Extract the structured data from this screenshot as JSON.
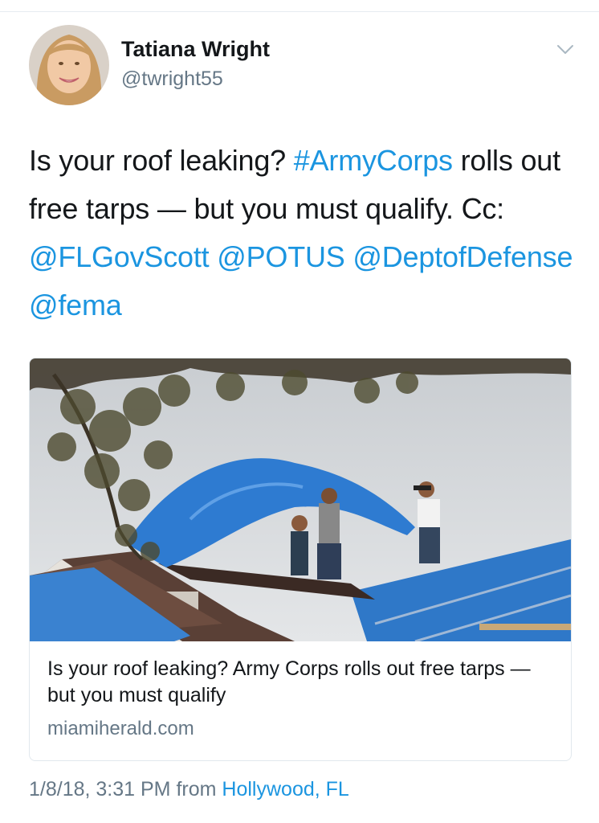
{
  "tweet": {
    "author": {
      "display_name": "Tatiana Wright",
      "handle": "@twright55"
    },
    "menu_icon": "chevron-down-icon",
    "text": {
      "part1": "Is your roof leaking? ",
      "hashtag": "#ArmyCorps",
      "part2": " rolls out free tarps — but you must qualify. Cc: ",
      "mention1": "@FLGovScott",
      "mention2": "@POTUS",
      "mention3": "@DeptofDefense",
      "mention4": "@fema"
    },
    "card": {
      "title": "Is your roof leaking? Army Corps rolls out free tarps — but you must qualify",
      "domain": "miamiherald.com"
    },
    "meta": {
      "timestamp": "1/8/18, 3:31 PM",
      "from_label": "from",
      "location": "Hollywood, FL"
    }
  },
  "colors": {
    "link": "#1b95e0",
    "secondary": "#657786",
    "tarp": "#2f78c8"
  }
}
